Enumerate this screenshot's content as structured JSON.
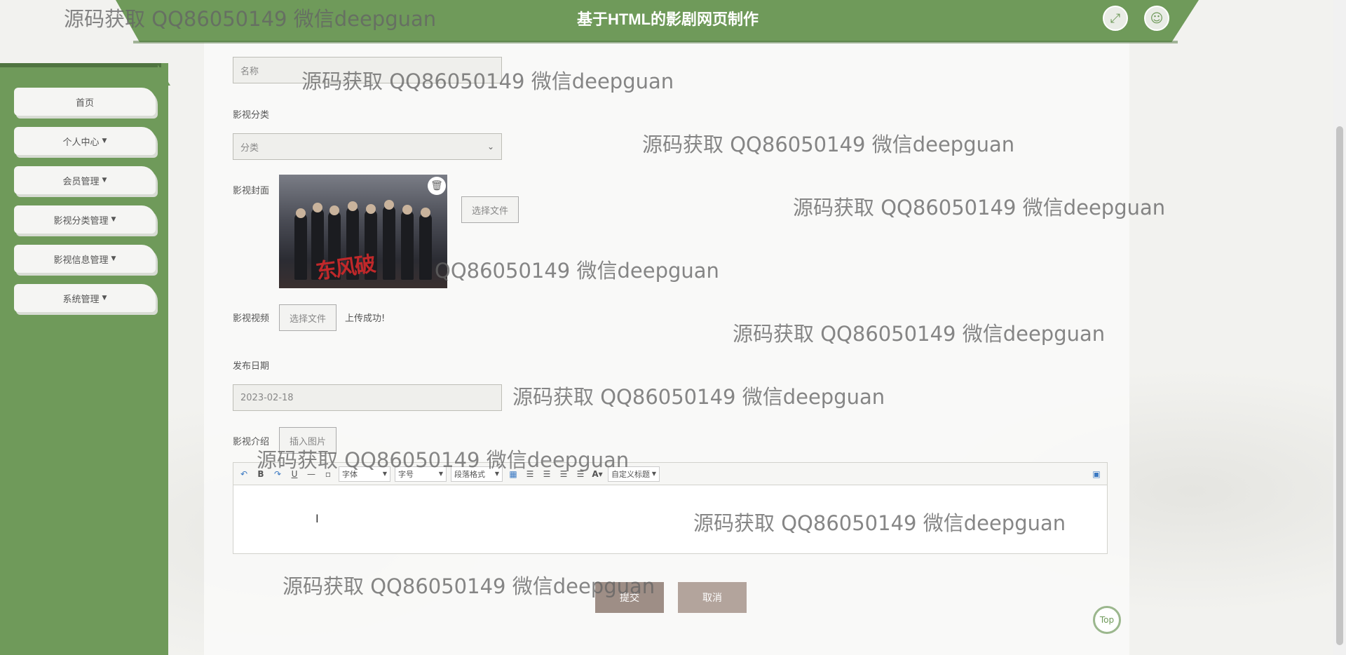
{
  "header": {
    "title": "基于HTML的影剧网页制作",
    "fullscreen_icon": "expand-icon",
    "user_icon": "user-icon"
  },
  "sidebar": {
    "items": [
      {
        "label": "首页",
        "has_caret": false
      },
      {
        "label": "个人中心",
        "has_caret": true
      },
      {
        "label": "会员管理",
        "has_caret": true
      },
      {
        "label": "影视分类管理",
        "has_caret": true
      },
      {
        "label": "影视信息管理",
        "has_caret": true
      },
      {
        "label": "系统管理",
        "has_caret": true
      }
    ]
  },
  "form": {
    "name_placeholder": "名称",
    "category_label": "影视分类",
    "category_value": "分类",
    "cover_label": "影视封面",
    "cover_choose_file": "选择文件",
    "cover_poster_text": "东风破",
    "video_label": "影视视频",
    "video_choose_file": "选择文件",
    "video_status": "上传成功!",
    "date_label": "发布日期",
    "date_value": "2023-02-18",
    "intro_label": "影视介绍",
    "insert_image": "插入图片"
  },
  "editor_toolbar": {
    "font_family": "字体",
    "font_size": "字号",
    "paragraph": "段落格式",
    "custom_title": "自定义标题"
  },
  "actions": {
    "submit": "提交",
    "cancel": "取消",
    "top": "Top"
  },
  "watermarks": [
    "源码获取 QQ86050149 微信deepguan",
    "源码获取 QQ86050149 微信deepguan",
    "源码获取 QQ86050149 微信deepguan",
    "源码获取 QQ86050149 微信deepguan",
    "QQ86050149 微信deepguan",
    "源码获取 QQ86050149 微信deepguan",
    "源码获取 QQ86050149 微信deepguan",
    "源码获取 QQ86050149 微信deepguan",
    "源码获取 QQ86050149 微信deepguan",
    "源码获取 QQ86050149 微信deepguan"
  ],
  "colors": {
    "brand_green": "#6f9a5a",
    "submit_bg": "#9e8e86",
    "cancel_bg": "#b3a49c"
  }
}
